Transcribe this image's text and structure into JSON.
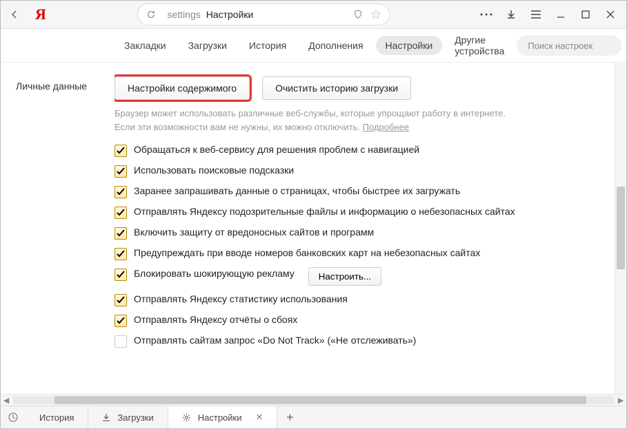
{
  "titlebar": {
    "url_prefix": "settings",
    "title": "Настройки"
  },
  "nav": {
    "items": [
      {
        "label": "Закладки"
      },
      {
        "label": "Загрузки"
      },
      {
        "label": "История"
      },
      {
        "label": "Дополнения"
      },
      {
        "label": "Настройки",
        "active": true
      },
      {
        "label": "Другие устройства"
      }
    ],
    "search_placeholder": "Поиск настроек"
  },
  "section": {
    "title": "Личные данные",
    "buttons": {
      "content": "Настройки содержимого",
      "clear": "Очистить историю загрузки"
    },
    "hint_line1": "Браузер может использовать различные веб-службы, которые упрощают работу в интернете.",
    "hint_line2": "Если эти возможности вам не нужны, их можно отключить. ",
    "hint_link": "Подробнее",
    "configure_btn": "Настроить...",
    "options": [
      {
        "label": "Обращаться к веб-сервису для решения проблем с навигацией",
        "checked": true
      },
      {
        "label": "Использовать поисковые подсказки",
        "checked": true
      },
      {
        "label": "Заранее запрашивать данные о страницах, чтобы быстрее их загружать",
        "checked": true
      },
      {
        "label": "Отправлять Яндексу подозрительные файлы и информацию о небезопасных сайтах",
        "checked": true
      },
      {
        "label": "Включить защиту от вредоносных сайтов и программ",
        "checked": true
      },
      {
        "label": "Предупреждать при вводе номеров банковских карт на небезопасных сайтах",
        "checked": true
      },
      {
        "label": "Блокировать шокирующую рекламу",
        "checked": true,
        "has_btn": true
      },
      {
        "label": "Отправлять Яндексу статистику использования",
        "checked": true
      },
      {
        "label": "Отправлять Яндексу отчёты о сбоях",
        "checked": true
      },
      {
        "label": "Отправлять сайтам запрос «Do Not Track» («Не отслеживать»)",
        "checked": false
      }
    ]
  },
  "bottombar": {
    "tabs": [
      {
        "label": "История",
        "icon": "clock"
      },
      {
        "label": "Загрузки",
        "icon": "download"
      },
      {
        "label": "Настройки",
        "icon": "gear",
        "active": true,
        "close": true
      }
    ]
  }
}
